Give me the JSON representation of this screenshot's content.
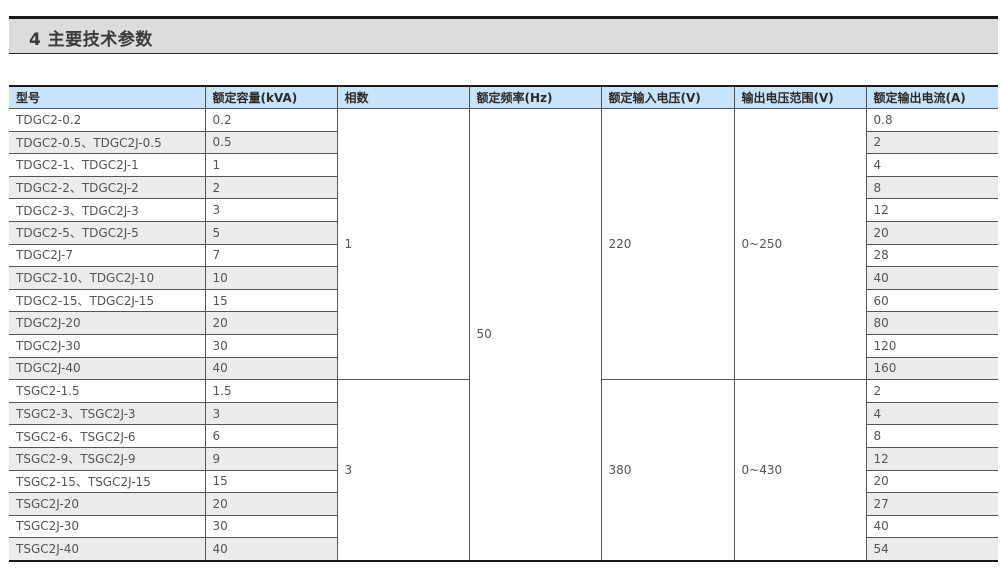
{
  "section": {
    "title": "4 主要技术参数"
  },
  "table": {
    "headers": [
      "型号",
      "额定容量(kVA)",
      "相数",
      "额定频率(Hz)",
      "额定输入电压(V)",
      "输出电压范围(V)",
      "额定输出电流(A)"
    ],
    "rows": [
      {
        "model": "TDGC2-0.2",
        "capacity": "0.2",
        "current": "0.8"
      },
      {
        "model": "TDGC2-0.5、TDGC2J-0.5",
        "capacity": "0.5",
        "current": "2"
      },
      {
        "model": "TDGC2-1、TDGC2J-1",
        "capacity": "1",
        "current": "4"
      },
      {
        "model": "TDGC2-2、TDGC2J-2",
        "capacity": "2",
        "current": "8"
      },
      {
        "model": "TDGC2-3、TDGC2J-3",
        "capacity": "3",
        "current": "12"
      },
      {
        "model": "TDGC2-5、TDGC2J-5",
        "capacity": "5",
        "current": "20"
      },
      {
        "model": "TDGC2J-7",
        "capacity": "7",
        "current": "28"
      },
      {
        "model": "TDGC2-10、TDGC2J-10",
        "capacity": "10",
        "current": "40"
      },
      {
        "model": "TDGC2-15、TDGC2J-15",
        "capacity": "15",
        "current": "60"
      },
      {
        "model": "TDGC2J-20",
        "capacity": "20",
        "current": "80"
      },
      {
        "model": "TDGC2J-30",
        "capacity": "30",
        "current": "120"
      },
      {
        "model": "TDGC2J-40",
        "capacity": "40",
        "current": "160"
      },
      {
        "model": "TSGC2-1.5",
        "capacity": "1.5",
        "current": "2"
      },
      {
        "model": "TSGC2-3、TSGC2J-3",
        "capacity": "3",
        "current": "4"
      },
      {
        "model": "TSGC2-6、TSGC2J-6",
        "capacity": "6",
        "current": "8"
      },
      {
        "model": "TSGC2-9、TSGC2J-9",
        "capacity": "9",
        "current": "12"
      },
      {
        "model": "TSGC2-15、TSGC2J-15",
        "capacity": "15",
        "current": "20"
      },
      {
        "model": "TSGC2J-20",
        "capacity": "20",
        "current": "27"
      },
      {
        "model": "TSGC2J-30",
        "capacity": "30",
        "current": "40"
      },
      {
        "model": "TSGC2J-40",
        "capacity": "40",
        "current": "54"
      }
    ],
    "groups": {
      "single_phase": {
        "phases": "1",
        "input_voltage": "220",
        "output_range": "0~250"
      },
      "three_phase": {
        "phases": "3",
        "input_voltage": "380",
        "output_range": "0~430"
      },
      "frequency": "50"
    }
  },
  "colors": {
    "header_bg": "#c9e3f8",
    "zebra_bg": "#ececec",
    "section_bg": "#dcdcdc"
  }
}
